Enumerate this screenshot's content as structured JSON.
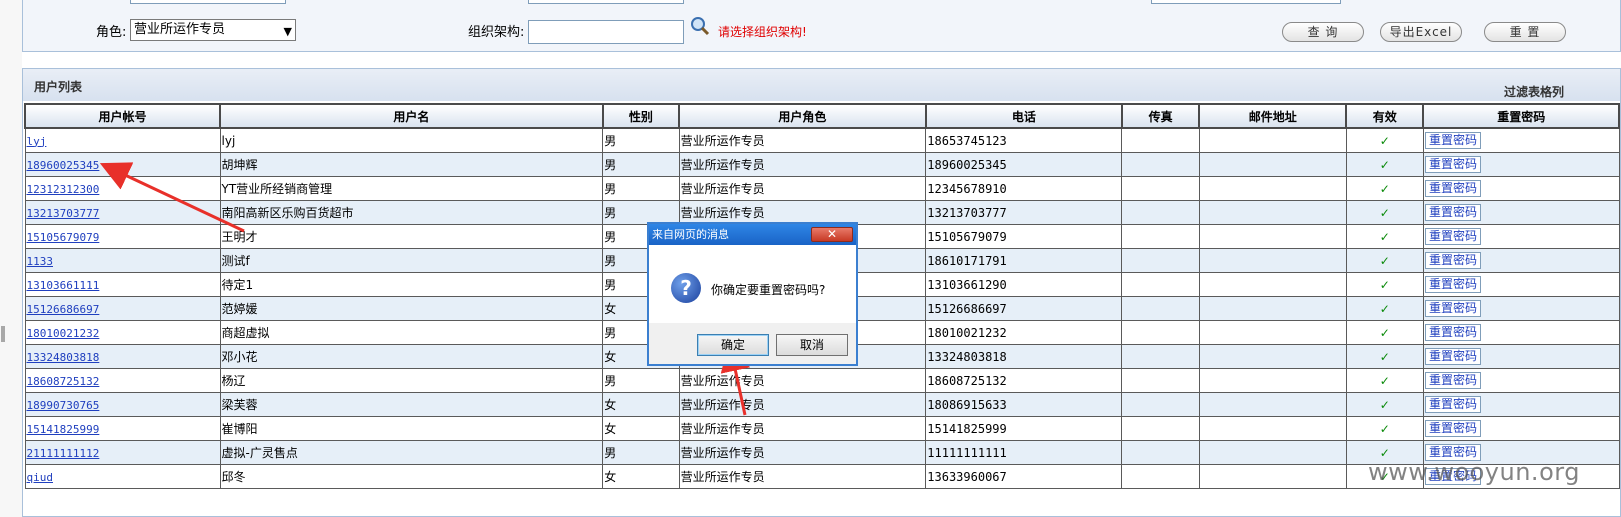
{
  "search": {
    "role_label": "角色:",
    "role_value": "营业所运作专员",
    "org_label": "组织架构:",
    "org_value": "",
    "org_hint": "请选择组织架构!",
    "query_button": "查 询",
    "export_button": "导出Excel",
    "reset_button": "重 置"
  },
  "list": {
    "title": "用户列表",
    "filter_link": "过滤表格列",
    "columns": [
      "用户帐号",
      "用户名",
      "性别",
      "用户角色",
      "电话",
      "传真",
      "邮件地址",
      "有效",
      "重置密码"
    ],
    "rows": [
      {
        "account": "lyj",
        "name": "lyj",
        "gender": "男",
        "role": "营业所运作专员",
        "phone": "18653745123",
        "fax": "",
        "email": "",
        "valid": "✓",
        "reset": "重置密码"
      },
      {
        "account": "18960025345",
        "name": "胡坤辉",
        "gender": "男",
        "role": "营业所运作专员",
        "phone": "18960025345",
        "fax": "",
        "email": "",
        "valid": "✓",
        "reset": "重置密码"
      },
      {
        "account": "12312312300",
        "name": "YT营业所经销商管理",
        "gender": "男",
        "role": "营业所运作专员",
        "phone": "12345678910",
        "fax": "",
        "email": "",
        "valid": "✓",
        "reset": "重置密码"
      },
      {
        "account": "13213703777",
        "name": "南阳高新区乐购百货超市",
        "gender": "男",
        "role": "营业所运作专员",
        "phone": "13213703777",
        "fax": "",
        "email": "",
        "valid": "✓",
        "reset": "重置密码"
      },
      {
        "account": "15105679079",
        "name": "王明才",
        "gender": "男",
        "role": "",
        "phone": "15105679079",
        "fax": "",
        "email": "",
        "valid": "✓",
        "reset": "重置密码"
      },
      {
        "account": "1133",
        "name": "测试f",
        "gender": "男",
        "role": "",
        "phone": "18610171791",
        "fax": "",
        "email": "",
        "valid": "✓",
        "reset": "重置密码"
      },
      {
        "account": "13103661111",
        "name": "待定1",
        "gender": "男",
        "role": "",
        "phone": "13103661290",
        "fax": "",
        "email": "",
        "valid": "✓",
        "reset": "重置密码"
      },
      {
        "account": "15126686697",
        "name": "范婷媛",
        "gender": "女",
        "role": "",
        "phone": "15126686697",
        "fax": "",
        "email": "",
        "valid": "✓",
        "reset": "重置密码"
      },
      {
        "account": "18010021232",
        "name": "商超虚拟",
        "gender": "男",
        "role": "",
        "phone": "18010021232",
        "fax": "",
        "email": "",
        "valid": "✓",
        "reset": "重置密码"
      },
      {
        "account": "13324803818",
        "name": "邓小花",
        "gender": "女",
        "role": "",
        "phone": "13324803818",
        "fax": "",
        "email": "",
        "valid": "✓",
        "reset": "重置密码"
      },
      {
        "account": "18608725132",
        "name": "杨辽",
        "gender": "男",
        "role": "营业所运作专员",
        "phone": "18608725132",
        "fax": "",
        "email": "",
        "valid": "✓",
        "reset": "重置密码"
      },
      {
        "account": "18990730765",
        "name": "梁芙蓉",
        "gender": "女",
        "role": "营业所运作专员",
        "phone": "18086915633",
        "fax": "",
        "email": "",
        "valid": "✓",
        "reset": "重置密码"
      },
      {
        "account": "15141825999",
        "name": "崔博阳",
        "gender": "女",
        "role": "营业所运作专员",
        "phone": "15141825999",
        "fax": "",
        "email": "",
        "valid": "✓",
        "reset": "重置密码"
      },
      {
        "account": "21111111112",
        "name": "虚拟-广灵售点",
        "gender": "男",
        "role": "营业所运作专员",
        "phone": "11111111111",
        "fax": "",
        "email": "",
        "valid": "✓",
        "reset": "重置密码"
      },
      {
        "account": "qiud",
        "name": "邱冬",
        "gender": "女",
        "role": "营业所运作专员",
        "phone": "13633960067",
        "fax": "",
        "email": "",
        "valid": "✓",
        "reset": "重置密码"
      }
    ]
  },
  "dialog": {
    "title": "来自网页的消息",
    "close": "✕",
    "icon": "question-icon",
    "message": "你确定要重置密码吗?",
    "ok": "确定",
    "cancel": "取消"
  },
  "watermark": "www.wooyun.org",
  "colors": {
    "link": "#1f3fbf",
    "hint": "#e00000",
    "valid_check": "#0a8a0a",
    "alt_row": "#e6eff8",
    "dialog_title": "#1963c6",
    "annotation_arrow": "#e8302a"
  }
}
